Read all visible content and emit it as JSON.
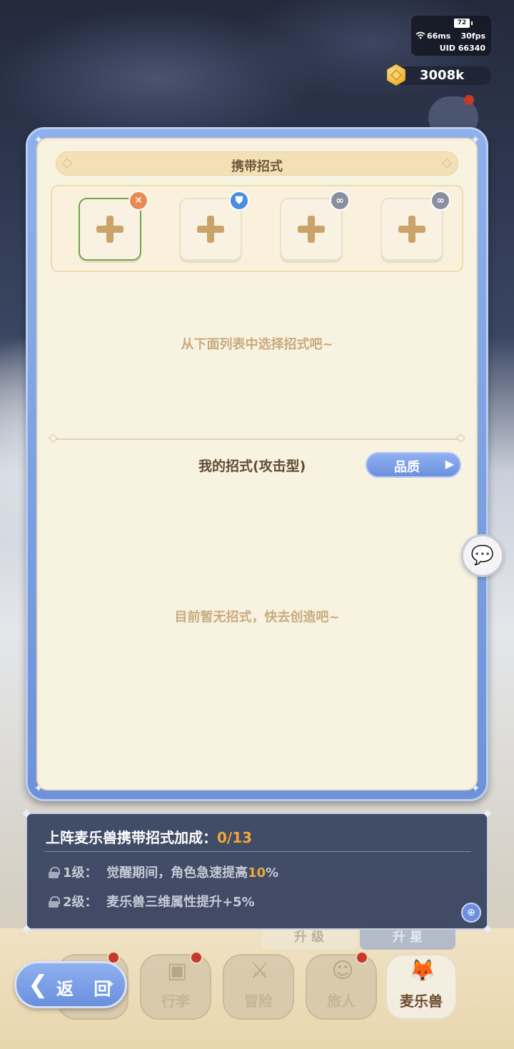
{
  "status": {
    "battery": "72",
    "ping": "66ms",
    "fps": "30fps",
    "uid": "UID 66340"
  },
  "currency": {
    "icon": "gold-coin-icon",
    "value": "3008k"
  },
  "panel": {
    "title": "携带招式",
    "slots": [
      {
        "badge_icon": "crossed-swords-icon",
        "badge_glyph": "✕",
        "selected": true
      },
      {
        "badge_icon": "shield-icon",
        "badge_glyph": "⛊",
        "selected": false
      },
      {
        "badge_icon": "link-icon",
        "badge_glyph": "∞",
        "selected": false
      },
      {
        "badge_icon": "link-icon",
        "badge_glyph": "∞",
        "selected": false
      }
    ],
    "hint": "从下面列表中选择招式吧~",
    "section_label": "我的招式(攻击型)",
    "quality_button": "品质",
    "empty_text": "目前暂无招式，快去创造吧~"
  },
  "bonus": {
    "title": "上阵麦乐兽携带招式加成：",
    "count": "0/13",
    "rows": [
      {
        "level": "1级：",
        "text_before": "觉醒期间，角色急速提高",
        "highlight": "10",
        "text_after": "%"
      },
      {
        "level": "2级：",
        "text_before": "麦乐兽三维属性提升+5%",
        "highlight": "",
        "text_after": ""
      }
    ]
  },
  "faded_buttons": [
    "升 级",
    "升 星"
  ],
  "nav": {
    "back_label": "返 回",
    "items": [
      {
        "label": "",
        "has_dot": true
      },
      {
        "label": "行李",
        "has_dot": true
      },
      {
        "label": "冒险",
        "has_dot": false
      },
      {
        "label": "旅人",
        "has_dot": true
      },
      {
        "label": "麦乐兽",
        "has_dot": false
      }
    ]
  },
  "colors": {
    "accent_blue": "#6c90de",
    "highlight_orange": "#f2a53a",
    "panel_bg": "#f8f2e1",
    "selected_green": "#6fa34a"
  }
}
